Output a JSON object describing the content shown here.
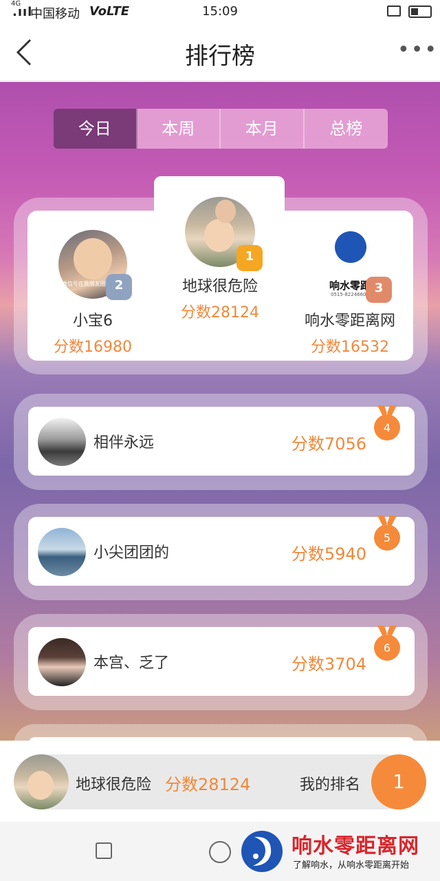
{
  "status_bar": {
    "signal": ".ııl",
    "network": "4G",
    "carrier": "中国移动",
    "volte": "VoLTE",
    "time": "15:09"
  },
  "header": {
    "title": "排行榜",
    "back_icon": "chevron-left-icon",
    "more_icon": "more-dots-icon",
    "more_text": "•••"
  },
  "tabs": [
    {
      "label": "今日",
      "selected": true
    },
    {
      "label": "本周",
      "selected": false
    },
    {
      "label": "本月",
      "selected": false
    },
    {
      "label": "总榜",
      "selected": false
    }
  ],
  "podium": {
    "first": {
      "name": "地球很危险",
      "score": "分数28124",
      "rank": "1"
    },
    "second": {
      "name": "小宝6",
      "score": "分数16980",
      "rank": "2",
      "avatar_caption": "微信号在我朋友圈 人好事"
    },
    "third": {
      "name": "响水零距离网",
      "score": "分数16532",
      "rank": "3",
      "avatar_logo_text": "响水零距",
      "avatar_phone": "0515-82246600"
    }
  },
  "ranking": [
    {
      "rank": "4",
      "name": "相伴永远",
      "score": "分数7056"
    },
    {
      "rank": "5",
      "name": "小尖团团的",
      "score": "分数5940"
    },
    {
      "rank": "6",
      "name": "本宫、乏了",
      "score": "分数3704"
    }
  ],
  "my_rank": {
    "name": "地球很危险",
    "score": "分数28124",
    "label": "我的排名",
    "position": "1"
  },
  "watermark": {
    "title": "响水零距离网",
    "subtitle": "了解响水，从响水零距离开始"
  },
  "colors": {
    "accent": "#f0883b",
    "tab_selected": "#7b3a78",
    "gold": "#f5a623",
    "silver": "#8fa3c0",
    "bronze": "#e08a6a",
    "watermark_red": "#d8262c"
  }
}
